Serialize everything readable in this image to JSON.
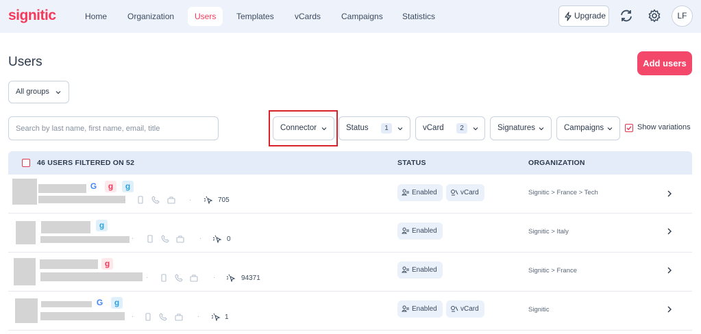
{
  "brand": {
    "logo": "signitic",
    "accent": "#f4395a"
  },
  "nav": [
    {
      "label": "Home",
      "active": false
    },
    {
      "label": "Organization",
      "active": false
    },
    {
      "label": "Users",
      "active": true
    },
    {
      "label": "Templates",
      "active": false
    },
    {
      "label": "vCards",
      "active": false
    },
    {
      "label": "Campaigns",
      "active": false
    },
    {
      "label": "Statistics",
      "active": false
    }
  ],
  "header_actions": {
    "upgrade_label": "Upgrade",
    "avatar_initials": "LF"
  },
  "page": {
    "title": "Users",
    "add_users_label": "Add users",
    "groups_select": "All groups"
  },
  "filters": {
    "search_placeholder": "Search by last name, first name, email, title",
    "connector": "Connector",
    "status": "Status",
    "status_count": "1",
    "vcard": "vCard",
    "vcard_count": "2",
    "signatures": "Signatures",
    "campaigns": "Campaigns",
    "show_variations": "Show variations"
  },
  "table": {
    "header_count": "46 USERS FILTERED ON 52",
    "col_status": "STATUS",
    "col_org": "ORGANIZATION",
    "rows": [
      {
        "connectors": [
          "google-icon",
          "gmail-icon",
          "signitic-g-icon"
        ],
        "count": "705",
        "status": "Enabled",
        "vcard": "vCard",
        "org": "Signitic > France > Tech"
      },
      {
        "connectors": [
          "signitic-g-icon"
        ],
        "count": "0",
        "status": "Enabled",
        "vcard": "",
        "org": "Signitic > Italy"
      },
      {
        "connectors": [
          "gmail-icon"
        ],
        "count": "94371",
        "status": "Enabled",
        "vcard": "",
        "org": "Signitic > France"
      },
      {
        "connectors": [
          "google-icon",
          "signitic-g-icon"
        ],
        "count": "1",
        "status": "Enabled",
        "vcard": "vCard",
        "org": "Signitic"
      }
    ]
  }
}
